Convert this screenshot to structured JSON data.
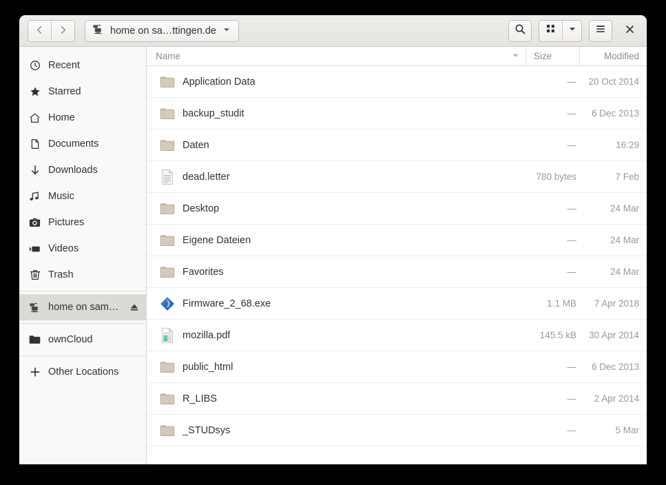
{
  "window": {
    "title": "home on sa…ttingen.de"
  },
  "headerbar": {
    "back_label": "Back",
    "forward_label": "Forward",
    "path_label": "home on sa…ttingen.de",
    "path_icon": "network-server-icon",
    "path_dropdown_icon": "chevron-down-icon",
    "search_label": "Search",
    "grid_view_label": "Grid view",
    "view_dropdown_label": "View options",
    "menu_label": "Main menu",
    "close_label": "Close"
  },
  "sidebar": {
    "items": [
      {
        "label": "Recent",
        "icon": "clock-icon",
        "selected": false,
        "eject": false
      },
      {
        "label": "Starred",
        "icon": "star-icon",
        "selected": false,
        "eject": false
      },
      {
        "label": "Home",
        "icon": "home-icon",
        "selected": false,
        "eject": false
      },
      {
        "label": "Documents",
        "icon": "document-icon",
        "selected": false,
        "eject": false
      },
      {
        "label": "Downloads",
        "icon": "download-arrow-icon",
        "selected": false,
        "eject": false
      },
      {
        "label": "Music",
        "icon": "music-note-icon",
        "selected": false,
        "eject": false
      },
      {
        "label": "Pictures",
        "icon": "camera-icon",
        "selected": false,
        "eject": false
      },
      {
        "label": "Videos",
        "icon": "video-camera-icon",
        "selected": false,
        "eject": false
      },
      {
        "label": "Trash",
        "icon": "trash-icon",
        "selected": false,
        "eject": false
      },
      {
        "label": "home on sam…",
        "icon": "network-server-icon",
        "selected": true,
        "eject": true
      },
      {
        "label": "ownCloud",
        "icon": "folder-icon",
        "selected": false,
        "eject": false
      },
      {
        "label": "Other Locations",
        "icon": "plus-icon",
        "selected": false,
        "eject": false
      }
    ],
    "separators_after": [
      8,
      9,
      10
    ]
  },
  "columns": {
    "name": "Name",
    "size": "Size",
    "modified": "Modified",
    "sort_icon": "sort-descending-icon"
  },
  "files": [
    {
      "name": "Application Data",
      "size": "—",
      "modified": "20 Oct 2014",
      "icon": "folder-icon"
    },
    {
      "name": "backup_studit",
      "size": "—",
      "modified": "6 Dec 2013",
      "icon": "folder-icon"
    },
    {
      "name": "Daten",
      "size": "—",
      "modified": "16:29",
      "icon": "folder-icon"
    },
    {
      "name": "dead.letter",
      "size": "780 bytes",
      "modified": "7 Feb",
      "icon": "text-file-icon"
    },
    {
      "name": "Desktop",
      "size": "—",
      "modified": "24 Mar",
      "icon": "folder-icon"
    },
    {
      "name": "Eigene Dateien",
      "size": "—",
      "modified": "24 Mar",
      "icon": "folder-icon"
    },
    {
      "name": "Favorites",
      "size": "—",
      "modified": "24 Mar",
      "icon": "folder-icon"
    },
    {
      "name": "Firmware_2_68.exe",
      "size": "1.1 MB",
      "modified": "7 Apr 2018",
      "icon": "wine-exe-icon"
    },
    {
      "name": "mozilla.pdf",
      "size": "145.5 kB",
      "modified": "30 Apr 2014",
      "icon": "pdf-file-icon"
    },
    {
      "name": "public_html",
      "size": "—",
      "modified": "6 Dec 2013",
      "icon": "folder-icon"
    },
    {
      "name": "R_LIBS",
      "size": "—",
      "modified": "2 Apr 2014",
      "icon": "folder-icon"
    },
    {
      "name": "_STUDsys",
      "size": "—",
      "modified": "5 Mar",
      "icon": "folder-icon"
    }
  ],
  "colors": {
    "folder": "#d5c9bb",
    "folder_border": "#b5a794",
    "exe_blue": "#2f6fc4",
    "selection": "#dcdad6",
    "desktop_background": "#000000"
  }
}
